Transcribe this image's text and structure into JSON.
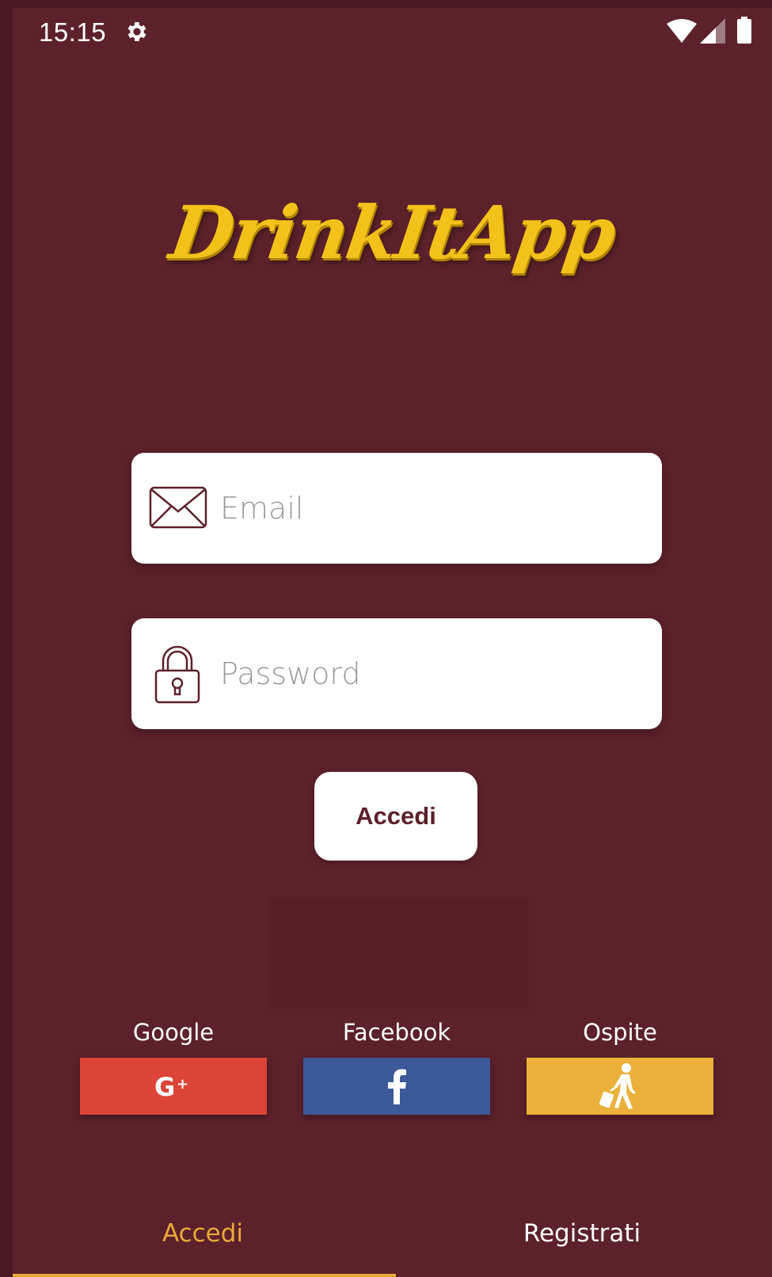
{
  "status_bar": {
    "time": "15:15"
  },
  "app": {
    "logo_text": "DrinkItApp"
  },
  "login_form": {
    "email_placeholder": "Email",
    "password_placeholder": "Password",
    "submit_label": "Accedi"
  },
  "social": [
    {
      "label": "Google",
      "icon": "google-plus-icon",
      "color": "#db4437"
    },
    {
      "label": "Facebook",
      "icon": "facebook-icon",
      "color": "#3b5998"
    },
    {
      "label": "Ospite",
      "icon": "traveler-icon",
      "color": "#ebb03a"
    }
  ],
  "tabs": [
    {
      "label": "Accedi",
      "selected": true,
      "color": "#e8a93a"
    },
    {
      "label": "Registrati",
      "selected": false,
      "color": "#ffffff"
    }
  ],
  "colors": {
    "background": "#5c212a",
    "accent": "#e8a93a",
    "logo": "#f2c21a"
  }
}
